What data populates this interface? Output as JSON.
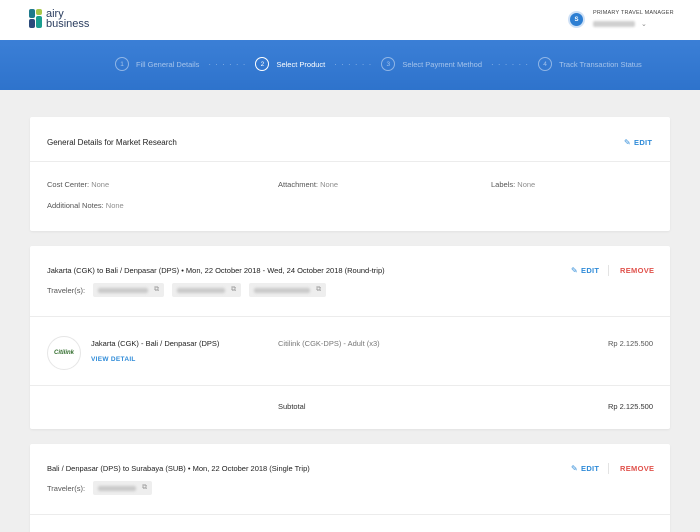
{
  "brand": {
    "line1": "airy",
    "line2": "business"
  },
  "user": {
    "avatar_text": "S",
    "role": "PRIMARY TRAVEL MANAGER",
    "chevron": "⌄"
  },
  "steps": [
    {
      "num": "1",
      "label": "Fill General Details",
      "active": false
    },
    {
      "num": "2",
      "label": "Select Product",
      "active": true
    },
    {
      "num": "3",
      "label": "Select Payment Method",
      "active": false
    },
    {
      "num": "4",
      "label": "Track Transaction Status",
      "active": false
    }
  ],
  "step_separator": "· · · · · ·",
  "general": {
    "title": "General Details for Market Research",
    "edit_label": "EDIT",
    "cost_center_label": "Cost Center:",
    "cost_center_value": "None",
    "attachment_label": "Attachment:",
    "attachment_value": "None",
    "labels_label": "Labels:",
    "labels_value": "None",
    "notes_label": "Additional Notes:",
    "notes_value": "None"
  },
  "trip1": {
    "title": "Jakarta (CGK) to Bali / Denpasar (DPS)  •  Mon, 22 October 2018 - Wed, 24 October 2018 (Round-trip)",
    "edit_label": "EDIT",
    "remove_label": "REMOVE",
    "travelers_label": "Traveler(s):",
    "flight": {
      "airline_logo_text": "Citilink",
      "route": "Jakarta (CGK) - Bali / Denpasar (DPS)",
      "view_detail": "VIEW DETAIL",
      "description": "Citilink (CGK-DPS) - Adult (x3)",
      "price": "Rp 2.125.500"
    },
    "subtotal_label": "Subtotal",
    "subtotal_value": "Rp 2.125.500"
  },
  "trip2": {
    "title": "Bali / Denpasar (DPS) to Surabaya (SUB)  •  Mon, 22 October 2018 (Single Trip)",
    "edit_label": "EDIT",
    "remove_label": "REMOVE",
    "travelers_label": "Traveler(s):"
  },
  "colors": {
    "accent": "#2f8bd8",
    "danger": "#e0524c",
    "header_blue": "#3b7fd6"
  }
}
